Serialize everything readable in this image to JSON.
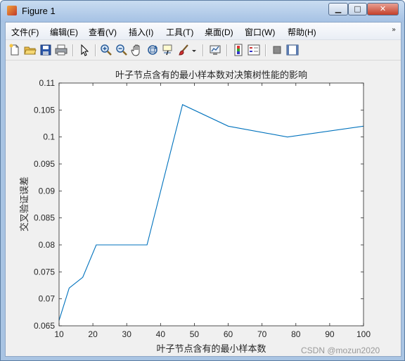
{
  "window": {
    "title": "Figure 1",
    "buttons": {
      "minimize": "▁",
      "maximize": "□",
      "close": "✕"
    }
  },
  "menubar": {
    "items": [
      {
        "label": "文件(F)"
      },
      {
        "label": "编辑(E)"
      },
      {
        "label": "查看(V)"
      },
      {
        "label": "插入(I)"
      },
      {
        "label": "工具(T)"
      },
      {
        "label": "桌面(D)"
      },
      {
        "label": "窗口(W)"
      },
      {
        "label": "帮助(H)"
      }
    ],
    "overflow_icon": "chevron-double-down-icon"
  },
  "toolbar": {
    "icons": [
      "new-figure-icon",
      "open-file-icon",
      "save-icon",
      "print-icon",
      "edit-plot-arrow-icon",
      "zoom-in-icon",
      "zoom-out-icon",
      "pan-hand-icon",
      "rotate-3d-icon",
      "data-cursor-icon",
      "brush-icon",
      "link-plot-icon",
      "colorbar-icon",
      "legend-icon",
      "hide-plot-tools-icon",
      "show-plot-tools-icon"
    ]
  },
  "chart_data": {
    "type": "line",
    "title": "叶子节点含有的最小样本数对决策树性能的影响",
    "xlabel": "叶子节点含有的最小样本数",
    "ylabel": "交叉验证误差",
    "xlim": [
      10,
      100
    ],
    "ylim": [
      0.065,
      0.11
    ],
    "xticks": [
      "10",
      "20",
      "30",
      "40",
      "50",
      "60",
      "70",
      "80",
      "90",
      "100"
    ],
    "yticks": [
      "0.065",
      "0.07",
      "0.075",
      "0.08",
      "0.085",
      "0.09",
      "0.095",
      "0.1",
      "0.105",
      "0.11"
    ],
    "grid": false,
    "series": [
      {
        "color": "#0072bd",
        "x": [
          10,
          13,
          17,
          21,
          36,
          46.5,
          60,
          77.5,
          100
        ],
        "y": [
          0.066,
          0.072,
          0.074,
          0.08,
          0.08,
          0.106,
          0.102,
          0.1,
          0.102
        ]
      }
    ]
  },
  "watermark": "CSDN @mozun2020"
}
